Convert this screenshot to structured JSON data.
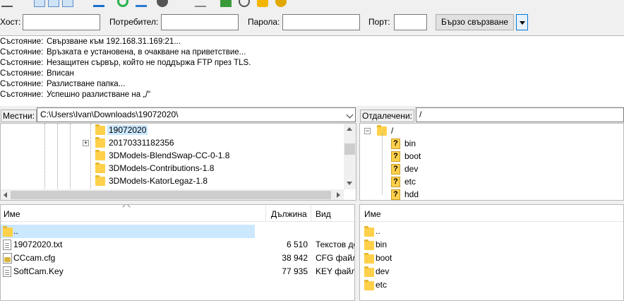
{
  "quickconnect": {
    "host_label": "Хост:",
    "host_value": "",
    "user_label": "Потребител:",
    "user_value": "",
    "pass_label": "Парола:",
    "pass_value": "",
    "port_label": "Порт:",
    "port_value": "",
    "connect_button": "Бързо свързване"
  },
  "log": [
    {
      "key": "Състояние:",
      "text": "Свързване към 192.168.31.169:21..."
    },
    {
      "key": "Състояние:",
      "text": "Връзката е установена, в очакване на приветствие..."
    },
    {
      "key": "Състояние:",
      "text": "Незащитен сървър, който не поддържа FTP през TLS."
    },
    {
      "key": "Състояние:",
      "text": "Вписан"
    },
    {
      "key": "Състояние:",
      "text": "Разлистване папка..."
    },
    {
      "key": "Състояние:",
      "text": "Успешно разлистване на „/“"
    }
  ],
  "local": {
    "label": "Местни:",
    "path": "C:\\Users\\Ivan\\Downloads\\19072020\\",
    "tree": [
      {
        "name": "19072020",
        "selected": true
      },
      {
        "name": "20170331182356",
        "expandable": true
      },
      {
        "name": "3DModels-BlendSwap-CC-0-1.8"
      },
      {
        "name": "3DModels-Contributions-1.8"
      },
      {
        "name": "3DModels-KatorLegaz-1.8"
      }
    ],
    "columns": {
      "name": "Име",
      "size": "Дължина",
      "type": "Вид"
    },
    "files": [
      {
        "name": "..",
        "size": "",
        "type": "",
        "icon": "folder-icon"
      },
      {
        "name": "19072020.txt",
        "size": "6 510",
        "type": "Текстов до",
        "icon": "text-file-icon"
      },
      {
        "name": "CCcam.cfg",
        "size": "38 942",
        "type": "CFG файл",
        "icon": "cfg-file-icon"
      },
      {
        "name": "SoftCam.Key",
        "size": "77 935",
        "type": "KEY файл",
        "icon": "file-icon"
      }
    ]
  },
  "remote": {
    "label": "Отдалечени:",
    "path": "/",
    "tree_root": "/",
    "tree": [
      {
        "name": "bin"
      },
      {
        "name": "boot"
      },
      {
        "name": "dev"
      },
      {
        "name": "etc"
      },
      {
        "name": "hdd"
      }
    ],
    "columns": {
      "name": "Име"
    },
    "files": [
      {
        "name": ".."
      },
      {
        "name": "bin"
      },
      {
        "name": "boot"
      },
      {
        "name": "dev"
      },
      {
        "name": "etc"
      }
    ]
  },
  "colors": {
    "selection": "#cce8ff",
    "folder": "#ffd04a",
    "accent": "#0078d7"
  }
}
